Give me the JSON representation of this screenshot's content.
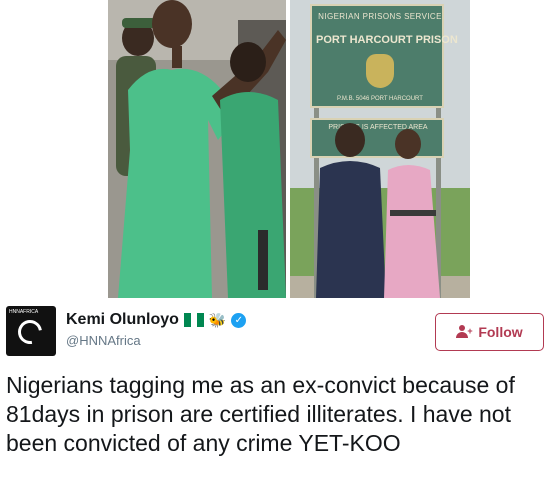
{
  "photos": {
    "left_alt": "",
    "sign": {
      "line1": "NIGERIAN PRISONS SERVICE",
      "line2": "PORT HARCOURT PRISON",
      "line3": "P.M.B. 5046 PORT HARCOURT",
      "line4": "PRISONS IS AFFECTED AREA"
    }
  },
  "tweet": {
    "author": {
      "display_name": "Kemi Olunloyo",
      "handle": "@HNNAfrica",
      "avatar_label": "HNNAFRICA",
      "badges": [
        "nigeria-flag-icon",
        "bee-icon",
        "verified-icon"
      ]
    },
    "follow_label": "Follow",
    "text": "Nigerians tagging me as an ex-convict because of 81days in prison are certified illiterates. I have not been convicted of any crime YET-KOO"
  },
  "colors": {
    "follow_accent": "#b23a52",
    "verified_blue": "#1da1f2",
    "text_primary": "#14171a",
    "text_secondary": "#657786",
    "flag_green": "#008751"
  }
}
